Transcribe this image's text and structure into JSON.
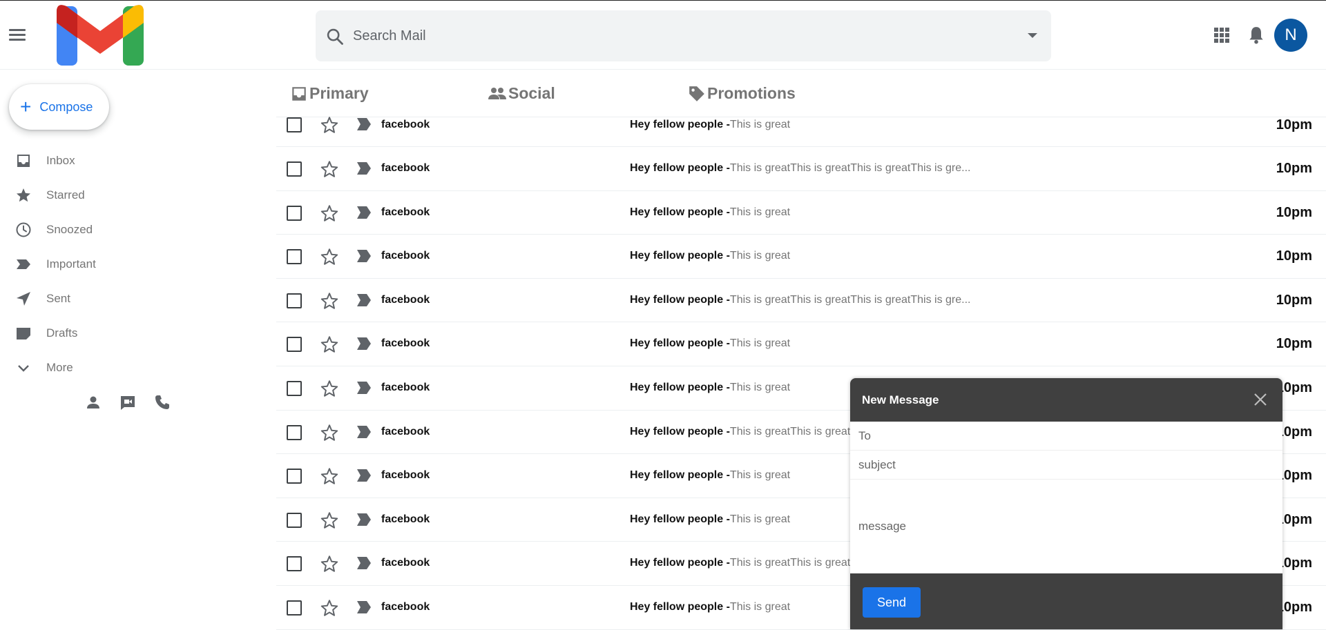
{
  "header": {
    "search_placeholder": "Search Mail",
    "avatar_initial": "N"
  },
  "sidebar": {
    "compose_label": "Compose",
    "items": [
      {
        "label": "Inbox",
        "icon": "inbox-icon"
      },
      {
        "label": "Starred",
        "icon": "star-icon"
      },
      {
        "label": "Snoozed",
        "icon": "clock-icon"
      },
      {
        "label": "Important",
        "icon": "label-important-icon"
      },
      {
        "label": "Sent",
        "icon": "send-icon"
      },
      {
        "label": "Drafts",
        "icon": "draft-icon"
      },
      {
        "label": "More",
        "icon": "chevron-down-icon"
      }
    ]
  },
  "tabs": [
    {
      "label": "Primary",
      "icon": "inbox-icon"
    },
    {
      "label": "Social",
      "icon": "people-icon"
    },
    {
      "label": "Promotions",
      "icon": "tag-icon"
    }
  ],
  "emails": [
    {
      "sender": "facebook",
      "subject": "Hey fellow people -",
      "snippet": "This is great",
      "time": "10pm"
    },
    {
      "sender": "facebook",
      "subject": "Hey fellow people -",
      "snippet": "This is greatThis is greatThis is greatThis is gre...",
      "time": "10pm"
    },
    {
      "sender": "facebook",
      "subject": "Hey fellow people -",
      "snippet": "This is great",
      "time": "10pm"
    },
    {
      "sender": "facebook",
      "subject": "Hey fellow people -",
      "snippet": "This is great",
      "time": "10pm"
    },
    {
      "sender": "facebook",
      "subject": "Hey fellow people -",
      "snippet": "This is greatThis is greatThis is greatThis is gre...",
      "time": "10pm"
    },
    {
      "sender": "facebook",
      "subject": "Hey fellow people -",
      "snippet": "This is great",
      "time": "10pm"
    },
    {
      "sender": "facebook",
      "subject": "Hey fellow people -",
      "snippet": "This is great",
      "time": "10pm"
    },
    {
      "sender": "facebook",
      "subject": "Hey fellow people -",
      "snippet": "This is greatThis is great",
      "time": "10pm"
    },
    {
      "sender": "facebook",
      "subject": "Hey fellow people -",
      "snippet": "This is great",
      "time": "10pm"
    },
    {
      "sender": "facebook",
      "subject": "Hey fellow people -",
      "snippet": "This is great",
      "time": "10pm"
    },
    {
      "sender": "facebook",
      "subject": "Hey fellow people -",
      "snippet": "This is greatThis is great",
      "time": "10pm"
    },
    {
      "sender": "facebook",
      "subject": "Hey fellow people -",
      "snippet": "This is great",
      "time": "10pm"
    }
  ],
  "compose_dialog": {
    "title": "New Message",
    "to_placeholder": "To",
    "subject_placeholder": "subject",
    "message_placeholder": "message",
    "send_label": "Send"
  },
  "colors": {
    "accent": "#1a73e8",
    "avatar": "#0b57a0",
    "dialog_header": "#404040"
  }
}
